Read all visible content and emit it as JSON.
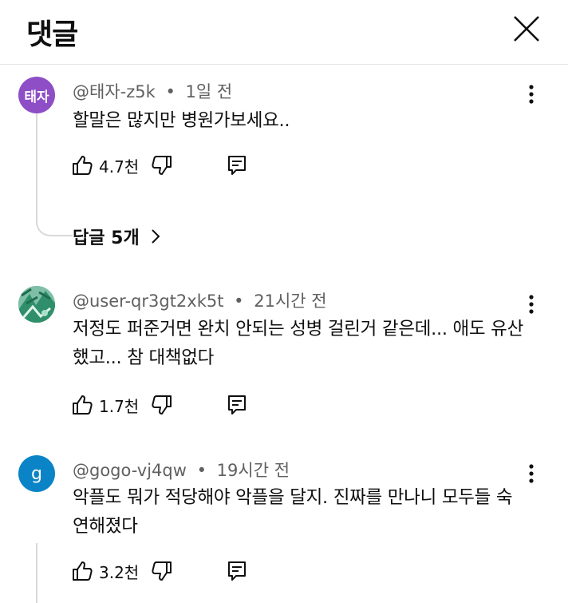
{
  "header": {
    "title": "댓글"
  },
  "comments": [
    {
      "avatar_text": "태자",
      "avatar_color": "#8e4ec6",
      "author": "@태자-z5k",
      "time": "1일 전",
      "text": "할말은 많지만 병원가보세요..",
      "likes": "4.7천",
      "replies_label": "답글 5개"
    },
    {
      "avatar_text": "",
      "avatar_color": "#2f9e75",
      "author": "@user-qr3gt2xk5t",
      "time": "21시간 전",
      "text": "저정도 퍼준거면 완치 안되는 성병 걸린거 같은데... 애도 유산했고... 참 대책없다",
      "likes": "1.7천"
    },
    {
      "avatar_text": "g",
      "avatar_color": "#0a84c6",
      "author": "@gogo-vj4qw",
      "time": "19시간 전",
      "text": "악플도 뭐가 적당해야 악플을 달지. 진짜를 만나니 모두들 숙연해졌다",
      "likes": "3.2천"
    }
  ],
  "separator": "•"
}
